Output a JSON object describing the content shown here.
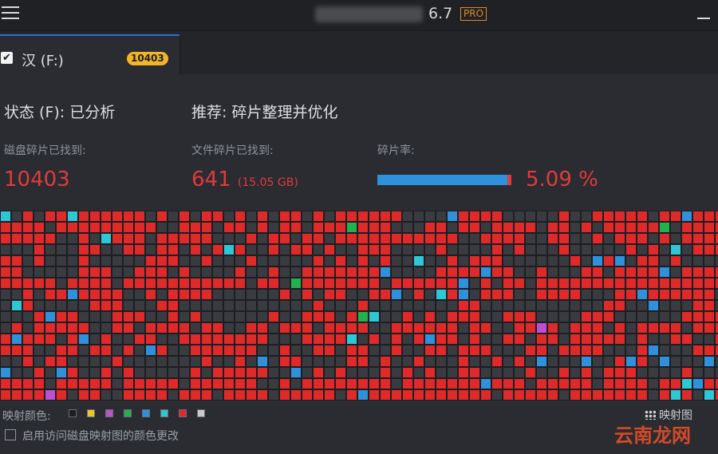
{
  "app": {
    "version": "6.7",
    "pro_badge": "PRO"
  },
  "tab": {
    "label": "汉 (F:)",
    "badge": "10403",
    "checkmark": "✔"
  },
  "status": {
    "text": "状态 (F): 已分析"
  },
  "recommendation": {
    "text": "推荐: 碎片整理并优化"
  },
  "stats": {
    "disk_fragments_label": "磁盘碎片已找到:",
    "disk_fragments_value": "10403",
    "file_fragments_label": "文件碎片已找到:",
    "file_fragments_value": "641",
    "file_fragments_size": "(15.05 GB)",
    "frag_rate_label": "碎片率:",
    "frag_rate_value": "5.09 %",
    "frag_rate_fraction": 0.0509
  },
  "legend": {
    "label": "映射颜色:",
    "colors": [
      "#1d1e22",
      "#f2c12e",
      "#c04ed0",
      "#22b14c",
      "#2f90dc",
      "#2fc6d6",
      "#e02a2a",
      "#c9c9c9"
    ]
  },
  "map_view_label": "映射图",
  "enable_color_change_label": "启用访问磁盘映射图的颜色更改",
  "watermark": "云南龙网",
  "palette": {
    "red": "#e02a2a",
    "dark": "#3a3b40",
    "blue": "#2f90dc",
    "cyan": "#2fc6d6",
    "green": "#22b14c",
    "purple": "#c04ed0",
    "yellow": "#f2c12e"
  }
}
